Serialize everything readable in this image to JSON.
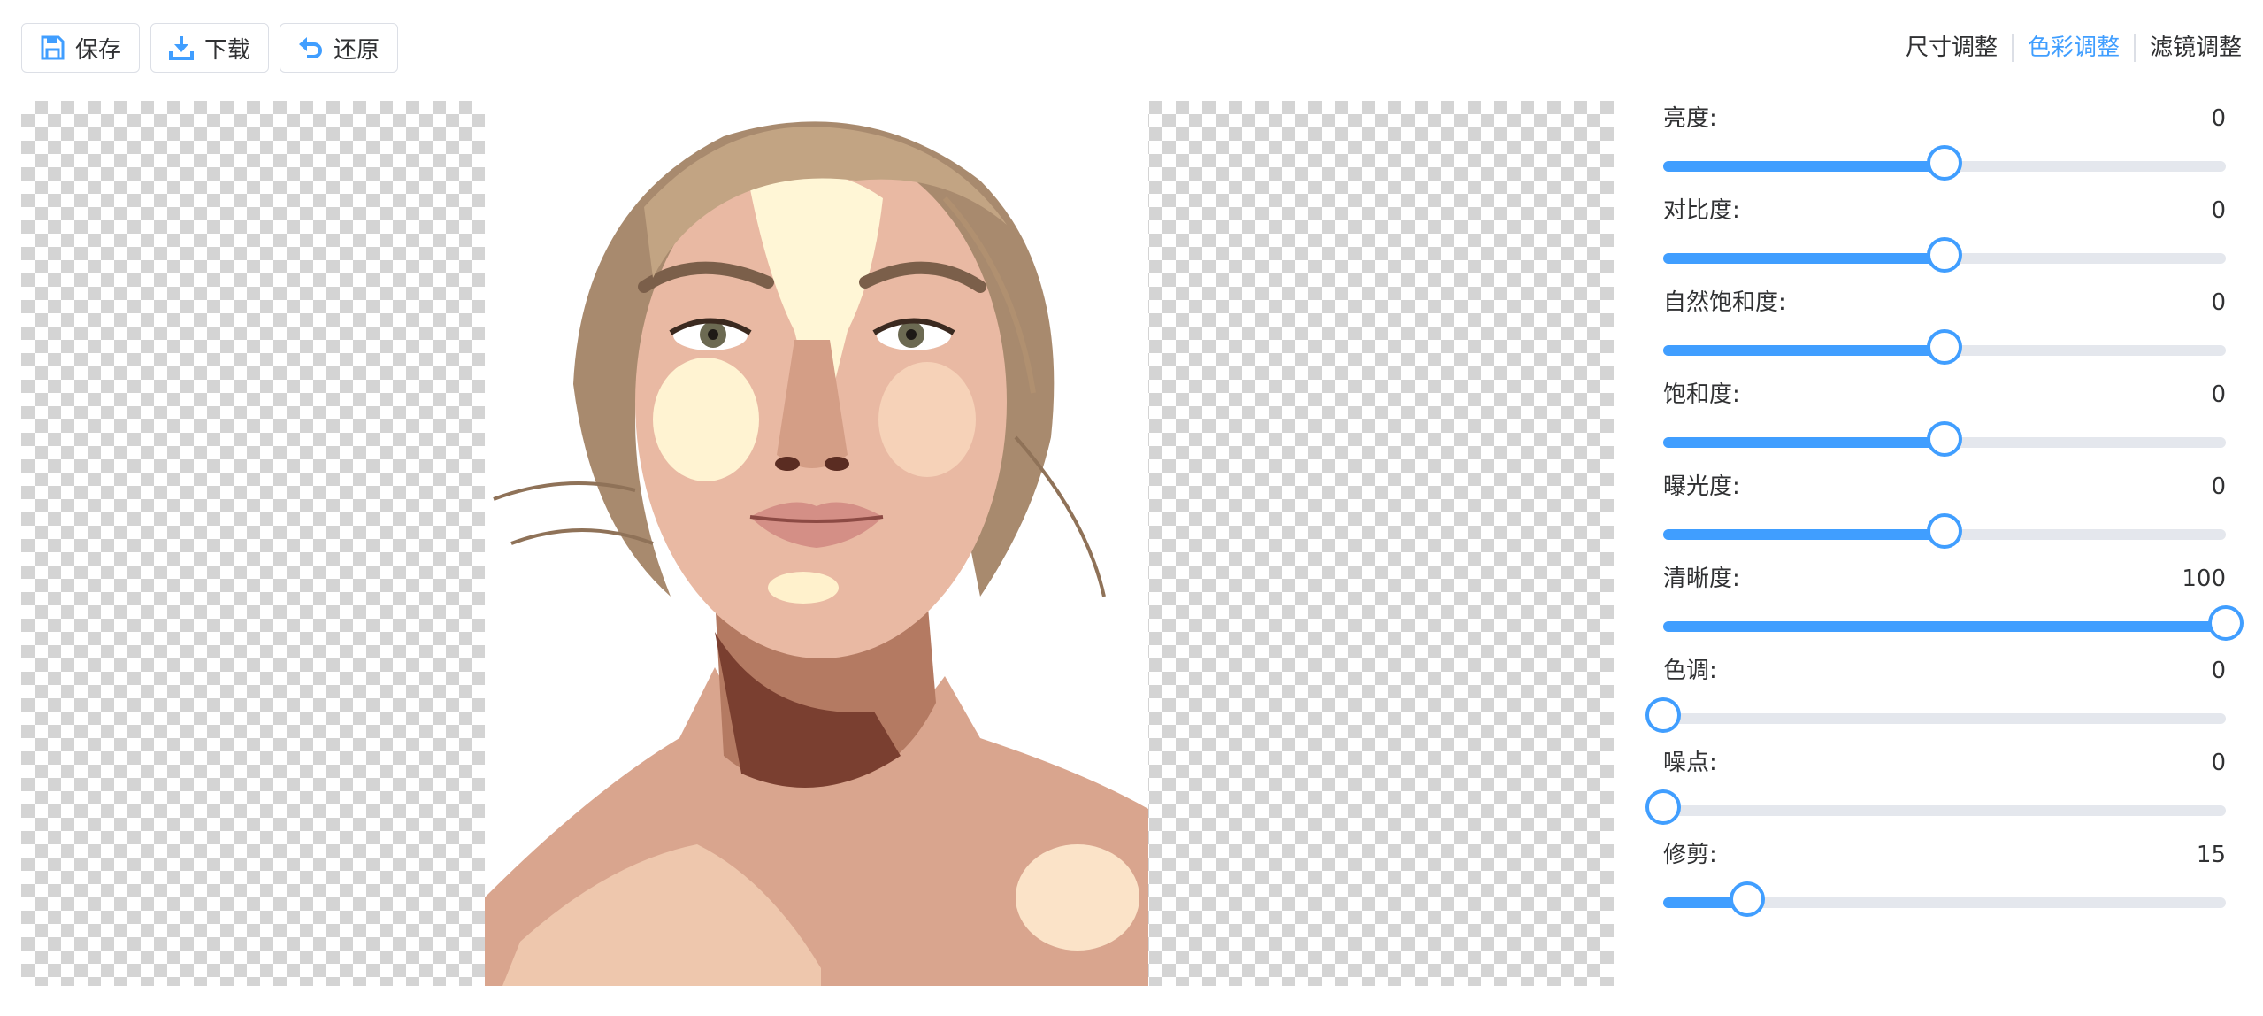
{
  "toolbar": {
    "buttons": [
      {
        "label": "保存",
        "icon": "save-icon"
      },
      {
        "label": "下载",
        "icon": "download-icon"
      },
      {
        "label": "还原",
        "icon": "undo-icon"
      }
    ]
  },
  "tabs": [
    {
      "label": "尺寸调整",
      "active": false
    },
    {
      "label": "色彩调整",
      "active": true
    },
    {
      "label": "滤镜调整",
      "active": false
    }
  ],
  "colors": {
    "accent": "#409eff",
    "track": "#e4e7ed",
    "text": "#303133"
  },
  "sliders": [
    {
      "label": "亮度:",
      "value": "0",
      "level": 0.5
    },
    {
      "label": "对比度:",
      "value": "0",
      "level": 0.5
    },
    {
      "label": "自然饱和度:",
      "value": "0",
      "level": 0.5
    },
    {
      "label": "饱和度:",
      "value": "0",
      "level": 0.5
    },
    {
      "label": "曝光度:",
      "value": "0",
      "level": 0.5
    },
    {
      "label": "清晰度:",
      "value": "100",
      "level": 1.0
    },
    {
      "label": "色调:",
      "value": "0",
      "level": 0.0
    },
    {
      "label": "噪点:",
      "value": "0",
      "level": 0.0
    },
    {
      "label": "修剪:",
      "value": "15",
      "level": 0.15
    }
  ]
}
